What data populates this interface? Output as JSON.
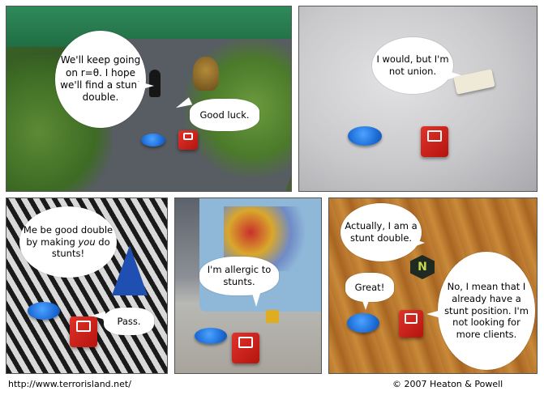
{
  "panels": [
    {
      "bubbles": [
        "We'll keep going on r=θ. I hope we'll find a stunt double.",
        "Good luck."
      ]
    },
    {
      "bubbles": [
        "I would, but I'm not union."
      ]
    },
    {
      "bubbles": [
        "Me be good double by making you do stunts!",
        "Pass."
      ],
      "bubble0_parts": {
        "before": "Me be good double by making ",
        "italic": "you",
        "after": " do stunts!"
      }
    },
    {
      "bubbles": [
        "I'm allergic to stunts."
      ]
    },
    {
      "bubbles": [
        "Actually, I am a stunt double.",
        "Great!",
        "No, I mean that I already have a stunt position. I'm not looking for more clients."
      ],
      "n_piece_letter": "N"
    }
  ],
  "footer": {
    "url": "http://www.terrorisland.net/",
    "copyright": "© 2007 Heaton & Powell"
  }
}
